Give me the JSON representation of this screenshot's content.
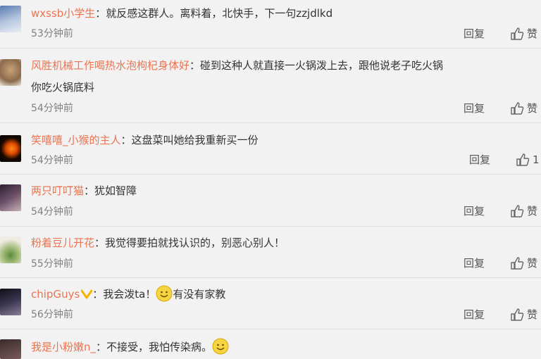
{
  "comments": [
    {
      "user": "wxssb小学生",
      "text": "就反感这群人。离料着，北快手，下一句zzjdlkd",
      "time": "53分钟前",
      "reply": "回复",
      "like": "赞"
    },
    {
      "user": "风胜机械工作喝热水泡枸杞身体好",
      "text": "碰到这种人就直接一火锅泼上去，跟他说老子吃火锅",
      "text2": "你吃火锅底料",
      "time": "54分钟前",
      "reply": "回复",
      "like": "赞"
    },
    {
      "user": "笑嘻嘻_小猴的主人",
      "text": "这盘菜叫她给我重新买一份",
      "time": "54分钟前",
      "reply": "回复",
      "like": "1"
    },
    {
      "user": "两只叮叮猫",
      "text": "犹如智障",
      "time": "54分钟前",
      "reply": "回复",
      "like": "赞"
    },
    {
      "user": "粉着豆儿开花",
      "text": "我觉得要拍就找认识的，别恶心别人！",
      "time": "55分钟前",
      "reply": "回复",
      "like": "赞"
    },
    {
      "user": "chipGuys",
      "text_a": "我会泼ta！",
      "text_b": "有没有家教",
      "time": "56分钟前",
      "reply": "回复",
      "like": "赞"
    },
    {
      "user": "我是小粉嫩n_",
      "text_a": "不接受，我怕传染病。",
      "time": "",
      "reply": "",
      "like": ""
    }
  ],
  "colors": {
    "username": "#eb7350",
    "time": "#808080",
    "background": "#f2f2f2"
  }
}
